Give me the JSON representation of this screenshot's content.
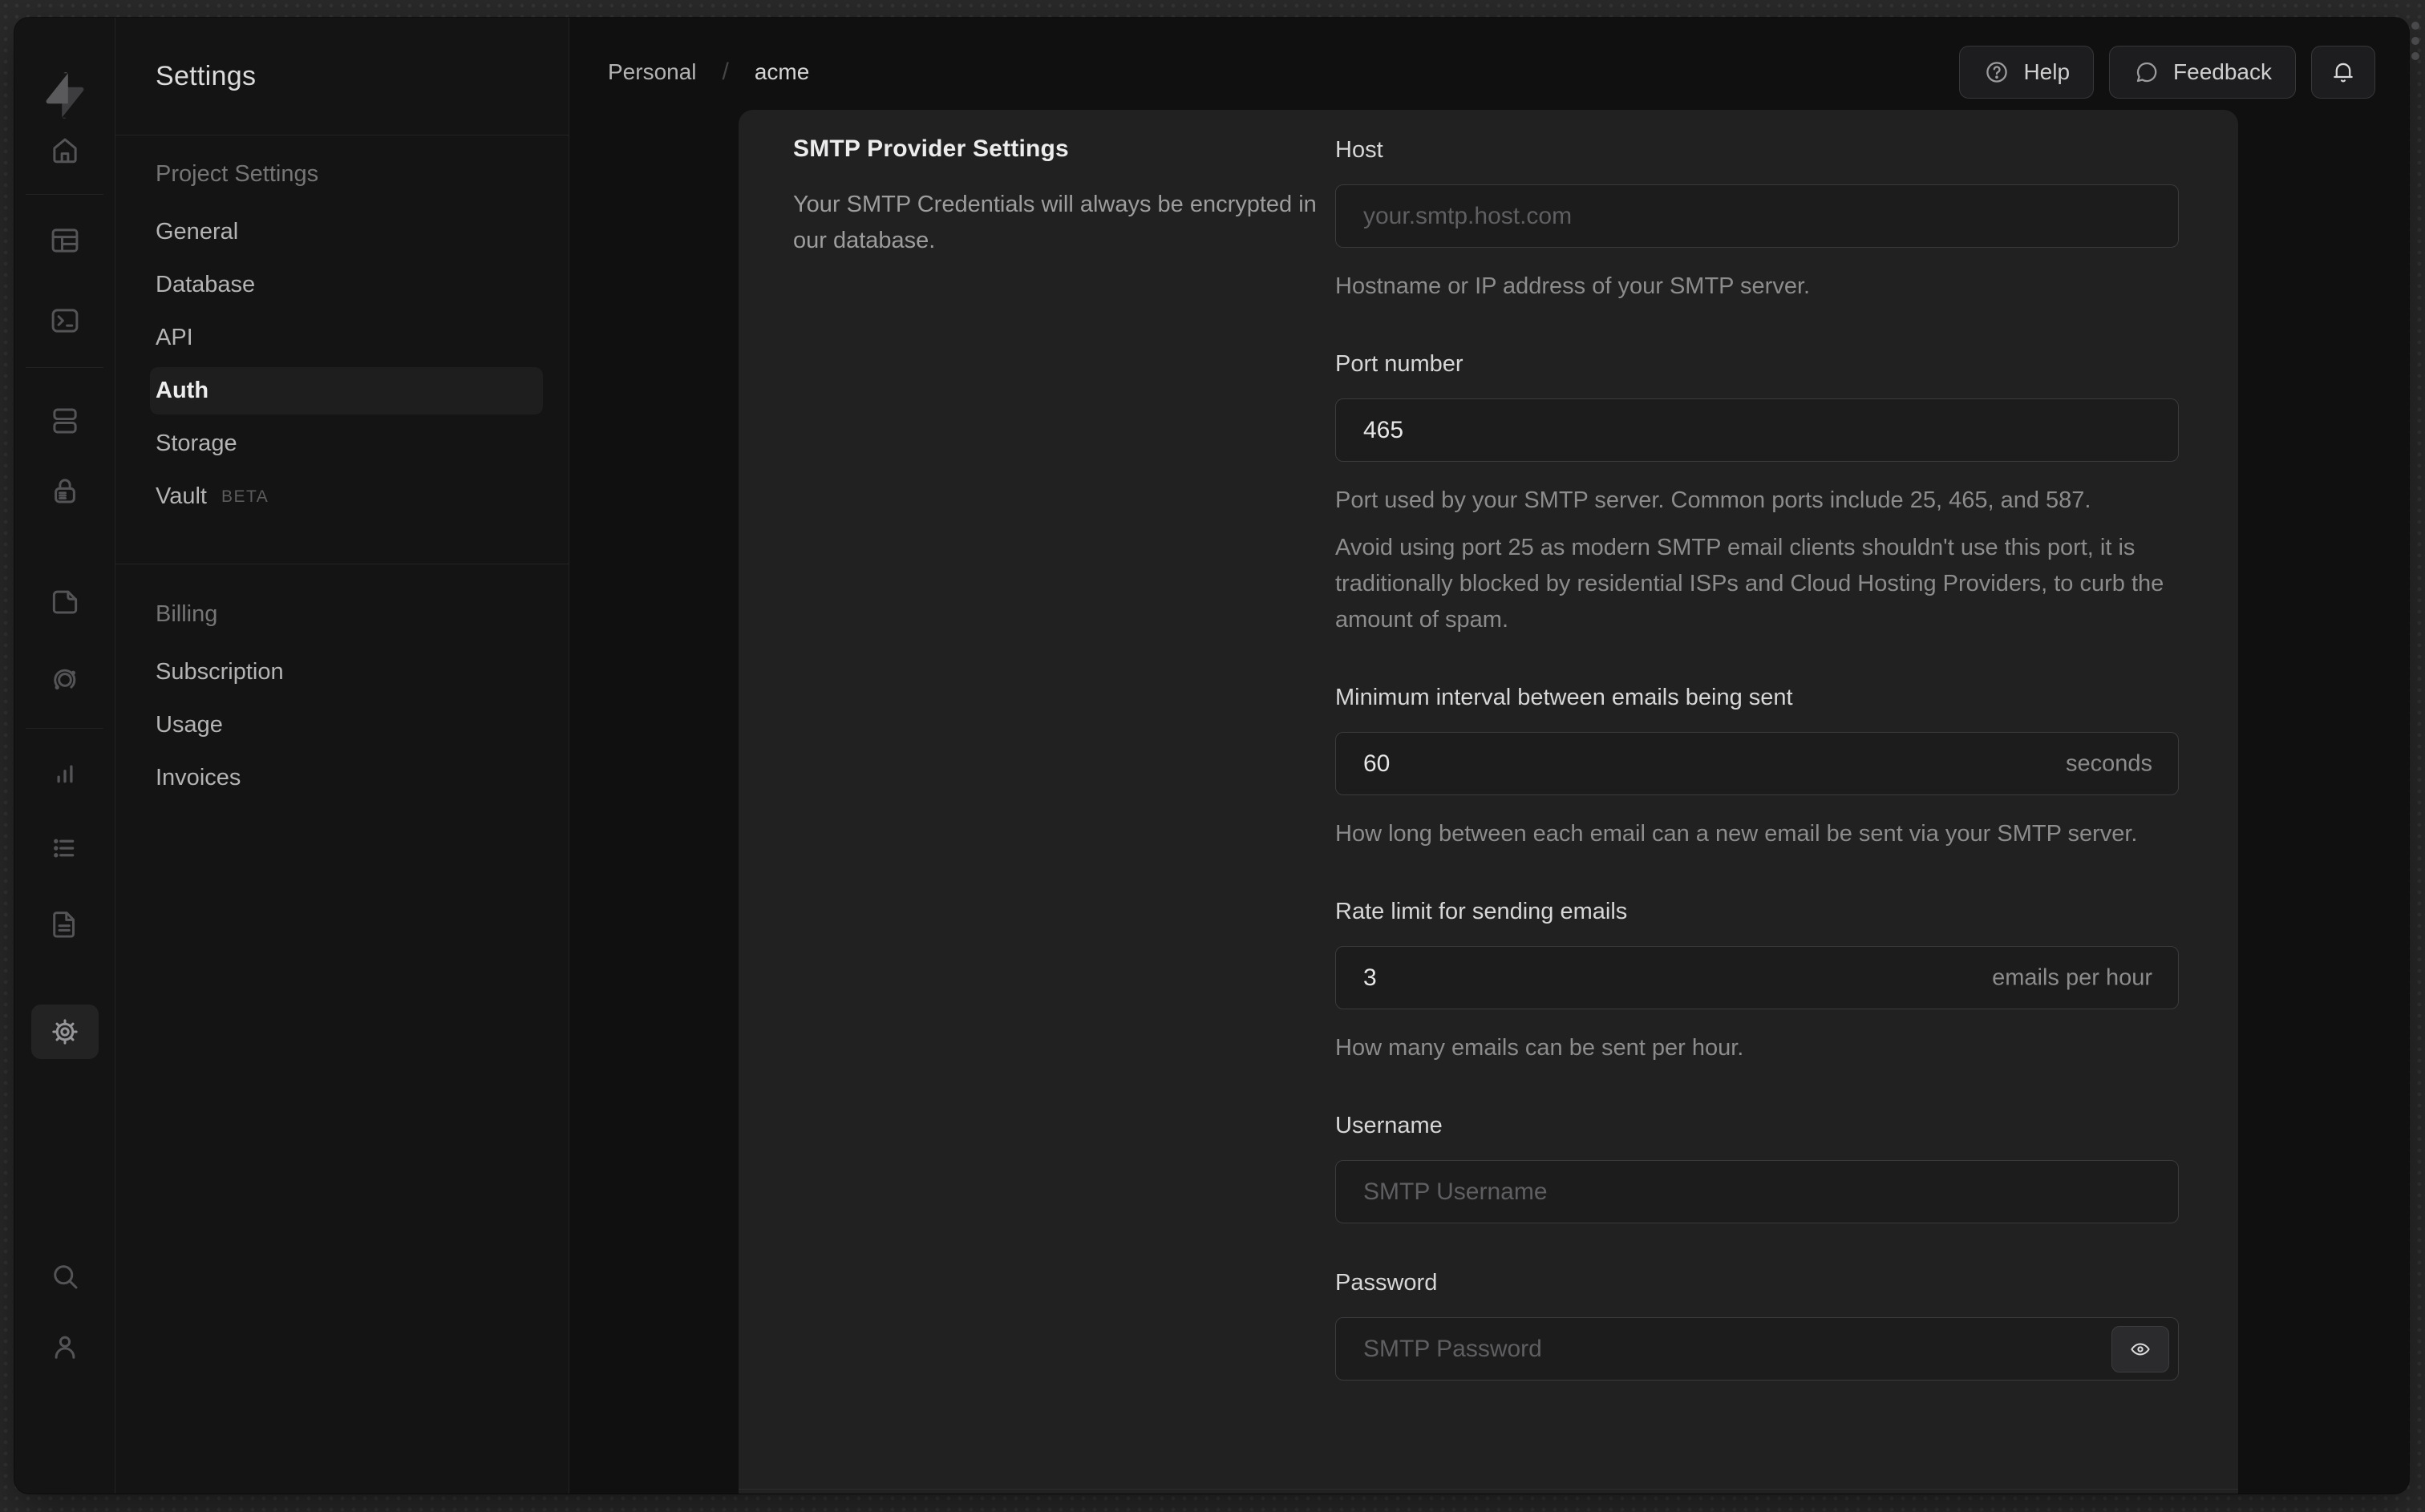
{
  "colors": {
    "frame_bg": "#2a2a2b",
    "window_bg": "#101011",
    "sidebar_bg": "#141415",
    "card_bg": "#212122",
    "input_bg": "#1c1c1d",
    "input_border": "#3b3b3d",
    "divider": "#232324",
    "text_primary": "#ececec",
    "text_secondary": "#8c8c8d",
    "active_item_bg": "#1e1e1f"
  },
  "rail": {
    "icons": [
      "supabase-logo",
      "home",
      "table-editor",
      "sql-editor",
      "database",
      "auth",
      "storage",
      "edge-functions",
      "reports",
      "logs",
      "api-docs",
      "settings",
      "search",
      "account"
    ],
    "active_icon": "settings"
  },
  "sidebar": {
    "title": "Settings",
    "sections": [
      {
        "header": "Project Settings",
        "items": [
          {
            "label": "General"
          },
          {
            "label": "Database"
          },
          {
            "label": "API"
          },
          {
            "label": "Auth",
            "active": true
          },
          {
            "label": "Storage"
          },
          {
            "label": "Vault",
            "badge": "BETA"
          }
        ]
      },
      {
        "header": "Billing",
        "items": [
          {
            "label": "Subscription"
          },
          {
            "label": "Usage"
          },
          {
            "label": "Invoices"
          }
        ]
      }
    ]
  },
  "header": {
    "breadcrumb": {
      "org": "Personal",
      "separator": "/",
      "project": "acme"
    },
    "actions": {
      "help_label": "Help",
      "feedback_label": "Feedback",
      "bell_icon": "notifications-bell"
    }
  },
  "card": {
    "title": "SMTP Provider Settings",
    "description": "Your SMTP Credentials will always be encrypted in our database.",
    "fields": [
      {
        "label": "Host",
        "placeholder": "your.smtp.host.com",
        "helper": "Hostname or IP address of your SMTP server."
      },
      {
        "label": "Port number",
        "value": "465",
        "helper": "Port used by your SMTP server. Common ports include 25, 465, and 587.",
        "note": "Avoid using port 25 as modern SMTP email clients shouldn't use this port, it is traditionally blocked by residential ISPs and Cloud Hosting Providers, to curb the amount of spam."
      },
      {
        "label": "Minimum interval between emails being sent",
        "value": "60",
        "suffix": "seconds",
        "helper": "How long between each email can a new email be sent via your SMTP server."
      },
      {
        "label": "Rate limit for sending emails",
        "value": "3",
        "suffix": "emails per hour",
        "helper": "How many emails can be sent per hour."
      },
      {
        "label": "Username",
        "placeholder": "SMTP Username"
      },
      {
        "label": "Password",
        "placeholder": "SMTP Password"
      }
    ]
  }
}
